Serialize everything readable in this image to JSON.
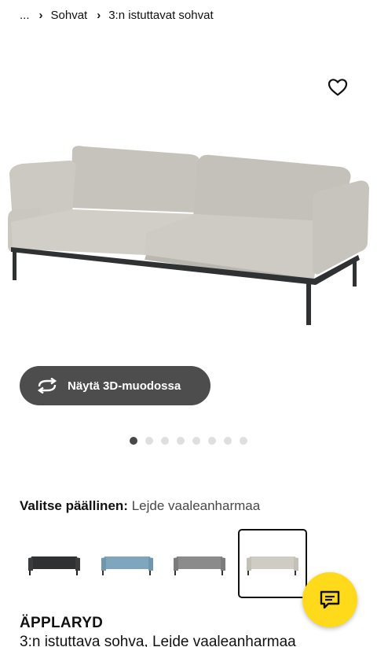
{
  "breadcrumb": {
    "items": [
      "...",
      "Sohvat",
      "3:n istuttavat sohvat"
    ]
  },
  "gallery": {
    "favorite_icon": "heart-outline-icon",
    "view_3d_label": "Näytä 3D-muodossa",
    "view_3d_icon": "rotate-arrows-icon",
    "image_count": 8,
    "active_image": 1
  },
  "cover": {
    "label": "Valitse päällinen:",
    "selected": "Lejde vaaleanharmaa",
    "options": [
      "dark-gray",
      "blue",
      "gray",
      "light-gray"
    ],
    "selected_index": 3
  },
  "product": {
    "name": "ÄPPLARYD",
    "description": "3:n istuttava sohva, Lejde vaaleanharmaa"
  },
  "chat": {
    "icon": "chat-bubble-icon"
  },
  "colors": {
    "accent_yellow": "#ffda1a",
    "button_dark": "#4d4d4d",
    "sofa_light": "#c9c7c0",
    "sofa_dark": "#2f3133",
    "sofa_blue": "#7fa6bd",
    "sofa_gray": "#8b8b8b",
    "sofa_beige": "#cfcdc3"
  }
}
